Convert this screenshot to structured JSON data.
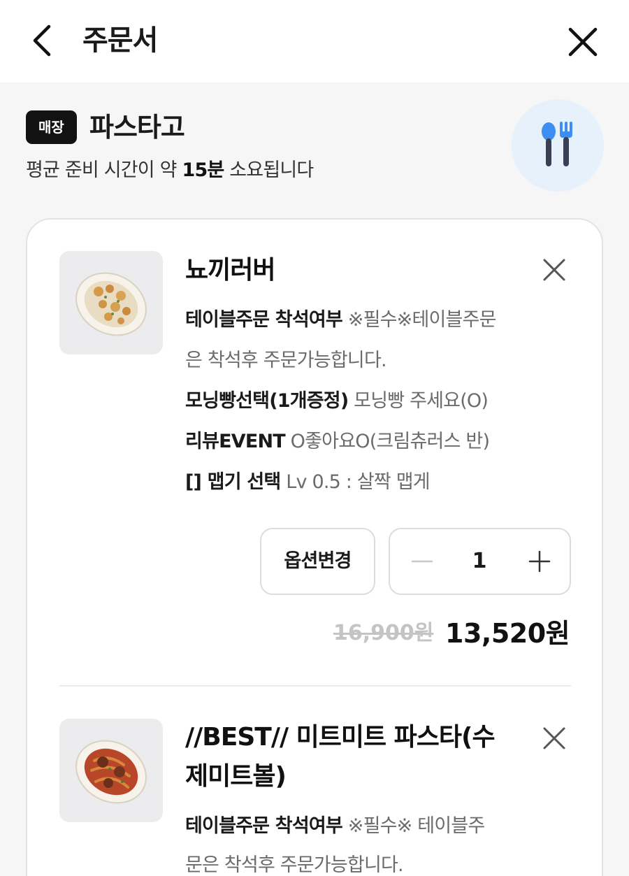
{
  "header": {
    "title": "주문서",
    "back_icon": "chevron-left-icon",
    "close_icon": "close-icon"
  },
  "store": {
    "badge": "매장",
    "name": "파스타고",
    "prep_prefix": "평균 준비 시간이 약 ",
    "prep_time": "15분",
    "prep_suffix": " 소요됩니다",
    "icon": "utensils-icon"
  },
  "items": [
    {
      "title": "뇨끼러버",
      "options": [
        {
          "key": "테이블주문 착석여부",
          "value": " ※필수※테이블주문"
        },
        {
          "key": "",
          "value": "은 착석후 주문가능합니다."
        },
        {
          "key": "모닝빵선택(1개증정)",
          "value": " 모닝빵 주세요(O)"
        },
        {
          "key": "리뷰EVENT",
          "value": " O좋아요O(크림츄러스 반)"
        },
        {
          "key": "[] 맵기 선택",
          "value": " Lv 0.5 : 살짝 맵게"
        }
      ],
      "option_change_label": "옵션변경",
      "quantity": "1",
      "original_price": "16,900원",
      "final_price": "13,520원"
    },
    {
      "title_line1": "//BEST// 미트미트 파스타(수",
      "title_line2": "제미트볼)",
      "options": [
        {
          "key": "테이블주문 착석여부",
          "value": " ※필수※ 테이블주"
        },
        {
          "key": "",
          "value": "문은 착석후 주문가능합니다."
        }
      ]
    }
  ],
  "colors": {
    "badge_bg": "#121212",
    "icon_circle": "#e6f1fc",
    "spoon_blue": "#3d8ef2",
    "strike_grey": "#c4c4c4"
  }
}
